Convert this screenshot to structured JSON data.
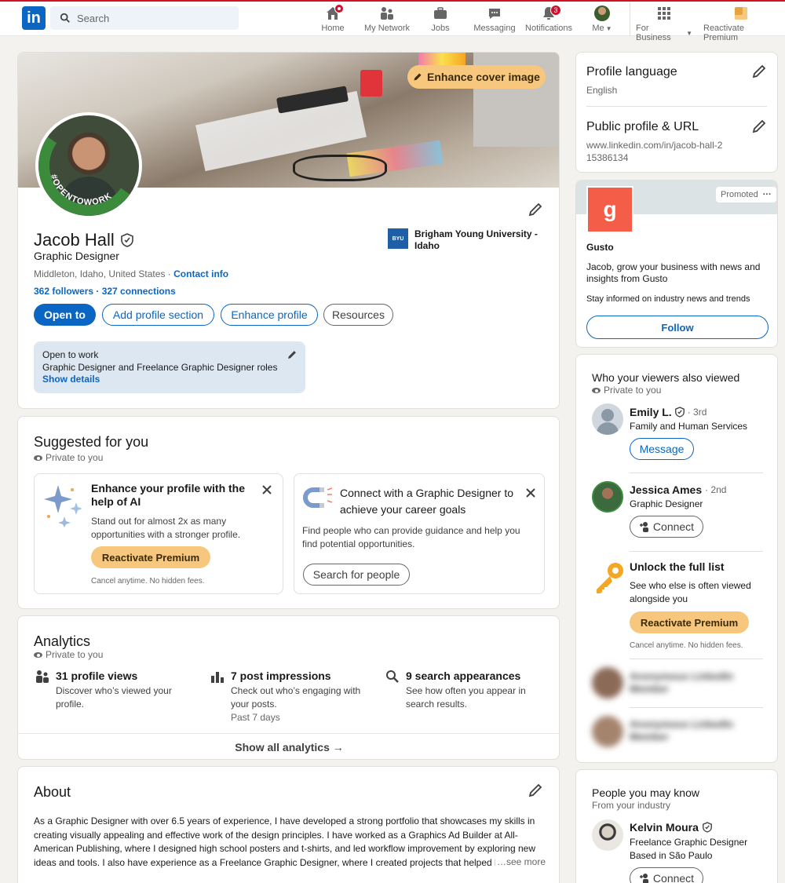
{
  "nav": {
    "search_placeholder": "Search",
    "items": [
      {
        "label": "Home",
        "icon": "home-icon"
      },
      {
        "label": "My Network",
        "icon": "network-icon"
      },
      {
        "label": "Jobs",
        "icon": "jobs-icon"
      },
      {
        "label": "Messaging",
        "icon": "messaging-icon"
      },
      {
        "label": "Notifications",
        "icon": "bell-icon",
        "badge": "3"
      },
      {
        "label": "Me",
        "icon": "avatar"
      }
    ],
    "business": "For Business",
    "premium": "Reactivate Premium",
    "logo": "in"
  },
  "profile": {
    "enhance_cover": "Enhance cover image",
    "open_to_work_ring": "#OPENTOWORK",
    "name": "Jacob Hall",
    "headline": "Graphic Designer",
    "location": "Middleton, Idaho, United States",
    "contact_sep": "·",
    "contact": "Contact info",
    "followers": "362 followers",
    "connections": "· 327 connections",
    "school_logo": "BYU",
    "school": "Brigham Young University - Idaho",
    "buttons": {
      "open_to": "Open to",
      "add_section": "Add profile section",
      "enhance": "Enhance profile",
      "resources": "Resources"
    },
    "otw": {
      "title": "Open to work",
      "roles": "Graphic Designer and Freelance Graphic Designer roles",
      "details": "Show details"
    }
  },
  "suggested": {
    "title": "Suggested for you",
    "private": "Private to you",
    "card1": {
      "title": "Enhance your profile with the help of AI",
      "desc": "Stand out for almost 2x as many opportunities with a stronger profile.",
      "button": "Reactivate Premium",
      "fine": "Cancel anytime. No hidden fees."
    },
    "card2": {
      "title": "Connect with a Graphic Designer to achieve your career goals",
      "desc": "Find people who can provide guidance and help you find potential opportunities.",
      "button": "Search for people"
    }
  },
  "analytics": {
    "title": "Analytics",
    "private": "Private to you",
    "items": [
      {
        "title": "31 profile views",
        "desc": "Discover who’s viewed your profile.",
        "icon": "people-icon"
      },
      {
        "title": "7 post impressions",
        "desc": "Check out who’s engaging with your posts.",
        "sub": "Past 7 days",
        "icon": "bar-chart-icon"
      },
      {
        "title": "9 search appearances",
        "desc": "See how often you appear in search results.",
        "icon": "search-icon"
      }
    ],
    "show_all": "Show all analytics →"
  },
  "about": {
    "title": "About",
    "text": "As a Graphic Designer with over 6.5 years of experience, I have developed a strong portfolio that showcases my skills in creating visually appealing and effective work of the design principles. I have worked as a Graphics Ad Builder at All-American Publishing, where I designed high school posters and t-shirts, and led workflow improvement by exploring new ideas and tools. I also have experience as a Freelance Graphic Designer, where I created projects that helped bu",
    "see_more": "…see more"
  },
  "sidebar": {
    "lang_title": "Profile language",
    "lang_value": "English",
    "url_title": "Public profile & URL",
    "url_value": "www.linkedin.com/in/jacob-hall-215386134",
    "ad": {
      "promoted": "Promoted",
      "more": "···",
      "logo": "g",
      "company": "Gusto",
      "text": "Jacob, grow your business with news and insights from Gusto",
      "sub": "Stay informed on industry news and trends",
      "follow": "Follow"
    },
    "viewers": {
      "title": "Who your viewers also viewed",
      "private": "Private to you",
      "people": [
        {
          "name": "Emily L.",
          "degree": "· 3rd",
          "headline": "Family and Human Services",
          "button": "Message"
        },
        {
          "name": "Jessica Ames",
          "degree": "· 2nd",
          "headline": "Graphic Designer",
          "button": "Connect"
        }
      ],
      "unlock_title": "Unlock the full list",
      "unlock_desc": "See who else is often viewed alongside you",
      "unlock_button": "Reactivate Premium",
      "unlock_fine": "Cancel anytime. No hidden fees.",
      "blurred": [
        {
          "name": "Anonymous LinkedIn",
          "sub": "Member"
        },
        {
          "name": "Anonymous LinkedIn",
          "sub": "Member"
        }
      ]
    },
    "pymk": {
      "title": "People you may know",
      "sub": "From your industry",
      "person": {
        "name": "Kelvin Moura",
        "headline": "Freelance Graphic Designer Based in São Paulo",
        "button": "Connect"
      }
    }
  }
}
